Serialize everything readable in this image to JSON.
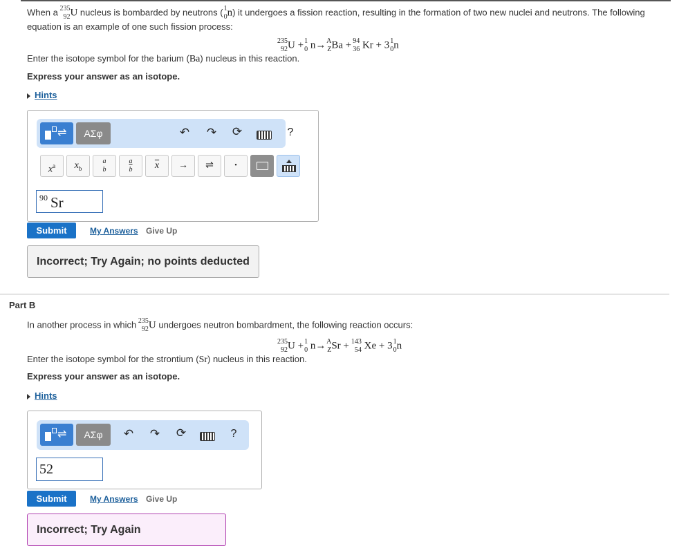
{
  "partA": {
    "intro_1": "When a",
    "intro_iso_mass": "235",
    "intro_iso_num": "92",
    "intro_iso_sym": "U",
    "intro_2": "nucleus is bombarded by neutrons (",
    "neutron_mass": "1",
    "neutron_num": "0",
    "neutron_sym": "n",
    "intro_3": ") it undergoes a fission reaction, resulting in the formation of two new nuclei and neutrons. The following",
    "intro_line2": "equation is an example of one such fission process:",
    "equation": {
      "u_mass": "235",
      "u_num": "92",
      "u_sym": "U",
      "plus1": "+",
      "n_mass": "1",
      "n_num": "0",
      "n_sym": "n",
      "arrow": "→",
      "ba_mass": "A",
      "ba_num": "Z",
      "ba_sym": "Ba",
      "plus2": "+",
      "kr_mass": "94",
      "kr_num": "36",
      "kr_sym": "Kr",
      "plus3": "+",
      "coef": "3",
      "n2_mass": "1",
      "n2_num": "0",
      "n2_sym": "n"
    },
    "question_1": "Enter the isotope symbol for the barium (",
    "question_sym": "Ba",
    "question_2": ") nucleus in this reaction.",
    "express": "Express your answer as an isotope.",
    "hints": "Hints",
    "toolbar": {
      "templates_label": "ΑΣφ",
      "help": "?"
    },
    "keys": {
      "sup_base": "x",
      "sup_exp": "a",
      "sub_base": "x",
      "sub_exp": "b",
      "frac_num": "a",
      "frac_den": "b",
      "frac2_num": "a",
      "frac2_den": "b",
      "xbar": "x",
      "arrow": "→",
      "equilibrium": "⇌",
      "dot": "•"
    },
    "answer_sup": "90",
    "answer_sym": "Sr",
    "submit": "Submit",
    "my_answers": "My Answers",
    "give_up": "Give Up",
    "feedback": "Incorrect; Try Again; no points deducted"
  },
  "partB": {
    "title": "Part B",
    "intro_1": "In another process in which",
    "intro_iso_mass": "235",
    "intro_iso_num": "92",
    "intro_iso_sym": "U",
    "intro_2": "undergoes neutron bombardment, the following reaction occurs:",
    "equation": {
      "u_mass": "235",
      "u_num": "92",
      "u_sym": "U",
      "plus1": "+",
      "n_mass": "1",
      "n_num": "0",
      "n_sym": "n",
      "arrow": "→",
      "sr_mass": "A",
      "sr_num": "Z",
      "sr_sym": "Sr",
      "plus2": "+",
      "xe_mass": "143",
      "xe_num": "54",
      "xe_sym": "Xe",
      "plus3": "+",
      "coef": "3",
      "n2_mass": "1",
      "n2_num": "0",
      "n2_sym": "n"
    },
    "question_1": "Enter the isotope symbol for the strontium (",
    "question_sym": "Sr",
    "question_2": ") nucleus in this reaction.",
    "express": "Express your answer as an isotope.",
    "hints": "Hints",
    "toolbar": {
      "templates_label": "ΑΣφ",
      "help": "?"
    },
    "answer_value": "52",
    "submit": "Submit",
    "my_answers": "My Answers",
    "give_up": "Give Up",
    "feedback": "Incorrect; Try Again"
  }
}
